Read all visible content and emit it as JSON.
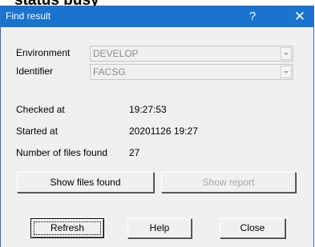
{
  "status_peek": "status busy",
  "dialog": {
    "title": "Find result",
    "help_glyph": "?",
    "close_glyph": "✕"
  },
  "environment": {
    "label": "Environment",
    "value": "DEVELOP"
  },
  "identifier": {
    "label": "Identifier",
    "value": "FACSG"
  },
  "info": {
    "checked_label": "Checked at",
    "checked_value": "19:27:53",
    "started_label": "Started at",
    "started_value": "20201126 19:27",
    "files_label": "Number of files found",
    "files_value": "27"
  },
  "buttons": {
    "show_files": "Show files found",
    "show_report": "Show report",
    "refresh": "Refresh",
    "help": "Help",
    "close": "Close"
  },
  "colors": {
    "titlebar": "#1a73cf",
    "dialog_bg": "#f0f0f0",
    "disabled_text": "#a8a8a8"
  }
}
